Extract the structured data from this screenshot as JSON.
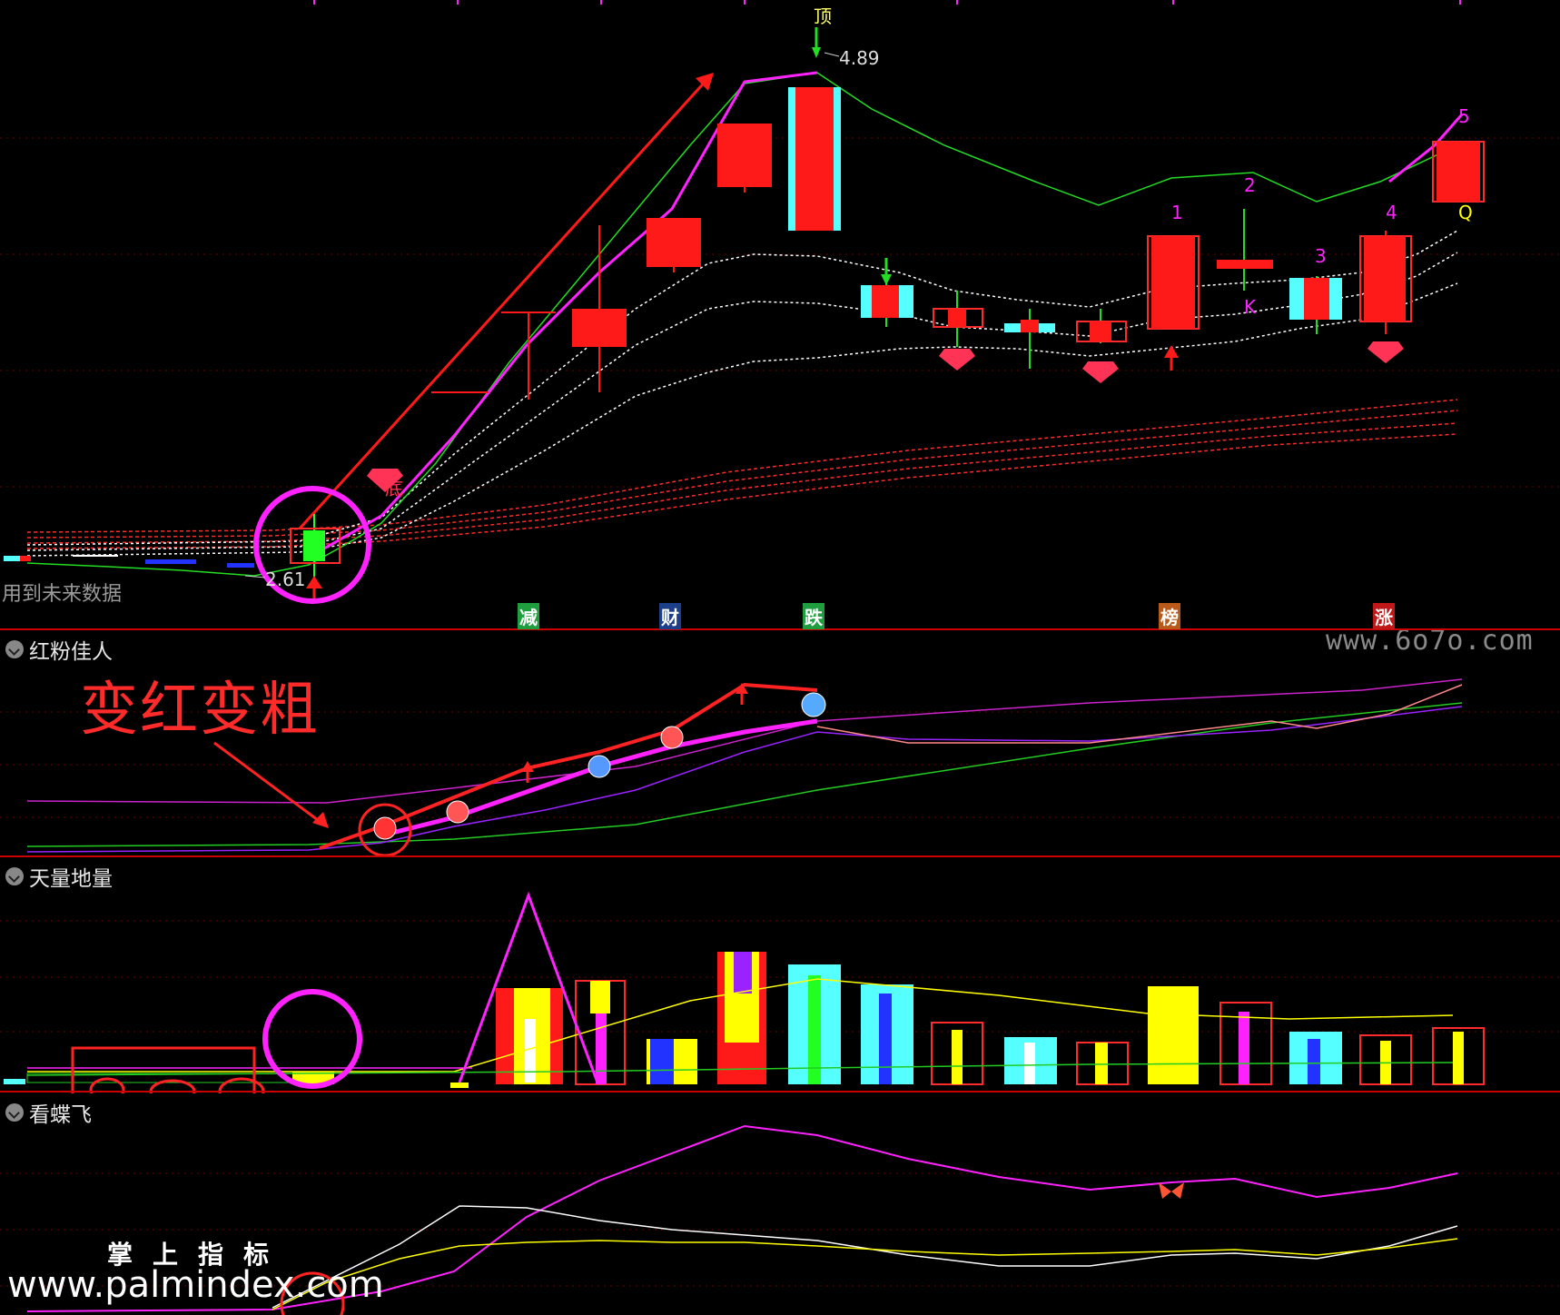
{
  "panes": {
    "main": {
      "note": "用到未来数据",
      "top_marker": "顶",
      "high_price": "4.89",
      "low_price": "2.61",
      "bottom_marker": "底",
      "wave_labels": [
        "1",
        "2",
        "3",
        "4",
        "5"
      ],
      "k_label": "K",
      "q_label": "Q",
      "tags": [
        {
          "text": "减",
          "color": "#1e9e3e"
        },
        {
          "text": "财",
          "color": "#1d3f8a"
        },
        {
          "text": "跌",
          "color": "#1e9e3e"
        },
        {
          "text": "榜",
          "color": "#b85a1a"
        },
        {
          "text": "涨",
          "color": "#c01818"
        }
      ]
    },
    "p2": {
      "title": "红粉佳人",
      "annotation": "变红变粗"
    },
    "p3": {
      "title": "天量地量"
    },
    "p4": {
      "title": "看蝶飞"
    }
  },
  "watermarks": {
    "site1": "www.6o7o.com",
    "site2_title": "掌上指标",
    "site2_url": "www.palmindex.com"
  },
  "colors": {
    "up": "#ff1a1a",
    "down": "#55ffff",
    "ma_green": "#22dd22",
    "magenta": "#ff22ff",
    "yellow": "#ffff00",
    "grid": "#7a0000"
  }
}
